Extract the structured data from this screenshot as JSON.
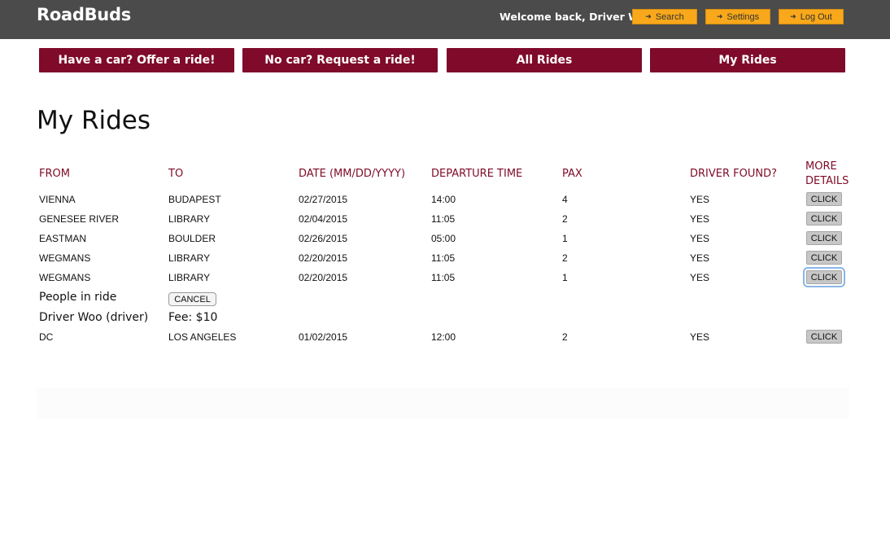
{
  "header": {
    "brand": "RoadBuds",
    "welcome": "Welcome back, Driver Woo!",
    "search_label": "Search",
    "settings_label": "Settings",
    "logout_label": "Log Out",
    "bar_color": "#4b4b4b",
    "button_color": "#f8a81a"
  },
  "nav": {
    "offer_label": "Have a car? Offer a ride!",
    "request_label": "No car? Request a ride!",
    "all_label": "All Rides",
    "mine_label": "My Rides",
    "color": "#7f0a29"
  },
  "page_title": "My Rides",
  "table": {
    "headers": {
      "from": "FROM",
      "to": "TO",
      "date": "DATE (MM/DD/YYYY)",
      "departure": "DEPARTURE TIME",
      "pax": "PAX",
      "driver_found": "DRIVER FOUND?",
      "more_line1": "MORE",
      "more_line2": "DETAILS"
    },
    "click_label": "CLICK",
    "rows": [
      {
        "from": "VIENNA",
        "to": "BUDAPEST",
        "date": "02/27/2015",
        "time": "14:00",
        "pax": "4",
        "driver_found": "YES"
      },
      {
        "from": "GENESEE RIVER",
        "to": "LIBRARY",
        "date": "02/04/2015",
        "time": "11:05",
        "pax": "2",
        "driver_found": "YES"
      },
      {
        "from": "EASTMAN",
        "to": "BOULDER",
        "date": "02/26/2015",
        "time": "05:00",
        "pax": "1",
        "driver_found": "YES"
      },
      {
        "from": "WEGMANS",
        "to": "LIBRARY",
        "date": "02/20/2015",
        "time": "11:05",
        "pax": "2",
        "driver_found": "YES"
      },
      {
        "from": "WEGMANS",
        "to": "LIBRARY",
        "date": "02/20/2015",
        "time": "11:05",
        "pax": "1",
        "driver_found": "YES"
      },
      {
        "from": "DC",
        "to": "LOS ANGELES",
        "date": "01/02/2015",
        "time": "12:00",
        "pax": "2",
        "driver_found": "YES"
      }
    ],
    "details": {
      "people_label": "People in ride",
      "cancel_label": "CANCEL",
      "driver": "Driver Woo (driver)",
      "fee": "Fee: $10"
    }
  }
}
